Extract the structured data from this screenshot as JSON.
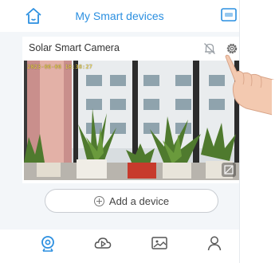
{
  "header": {
    "title": "My Smart devices",
    "home_icon": "home-icon",
    "message_icon": "message-icon",
    "accent_color": "#2b8fe0"
  },
  "camera_card": {
    "name": "Solar Smart Camera",
    "timestamp": "2023-06-06 18:38:27",
    "alarm_icon": "bell-off-icon",
    "settings_icon": "gear-icon",
    "fullscreen_icon": "fullscreen-icon"
  },
  "add_device": {
    "label": "Add a device",
    "icon": "plus-circle-icon"
  },
  "bottom_nav": {
    "items": [
      {
        "icon": "camera-search-icon",
        "active": true
      },
      {
        "icon": "cloud-play-icon",
        "active": false
      },
      {
        "icon": "album-icon",
        "active": false
      },
      {
        "icon": "user-icon",
        "active": false
      }
    ],
    "active_color": "#2b8fe0",
    "inactive_color": "#555555"
  }
}
